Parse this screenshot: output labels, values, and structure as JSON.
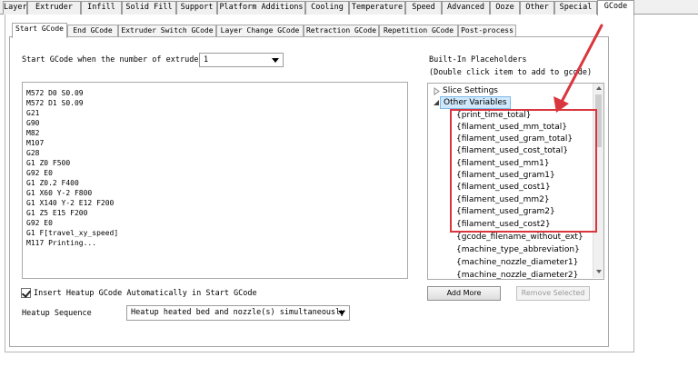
{
  "top_tabs": {
    "items": [
      "Layer",
      "Extruder",
      "Infill",
      "Solid Fill",
      "Support",
      "Platform Additions",
      "Cooling",
      "Temperature",
      "Speed",
      "Advanced",
      "Ooze",
      "Other",
      "Special",
      "GCode"
    ],
    "active": "GCode"
  },
  "sub_tabs": {
    "items": [
      "Start GCode",
      "End GCode",
      "Extruder Switch GCode",
      "Layer Change GCode",
      "Retraction GCode",
      "Repetition GCode",
      "Post-process"
    ],
    "active": "Start GCode"
  },
  "extruder_count": {
    "label": "Start GCode when the number of extruders is",
    "value": "1"
  },
  "gcode_lines": [
    "M572 D0 S0.09",
    "M572 D1 S0.09",
    "G21",
    "G90",
    "M82",
    "M107",
    "G28",
    "G1 Z0 F500",
    "G92 E0",
    "G1 Z0.2 F400",
    "G1 X60 Y-2 F800",
    "G1 X140 Y-2 E12 F200",
    "G1 Z5 E15 F200",
    "G92 E0",
    "G1 F[travel_xy_speed]",
    "M117 Printing..."
  ],
  "placeholders": {
    "title": "Built-In Placeholders",
    "hint": "(Double click item to add to gcode)",
    "groups": [
      "Slice Settings",
      "Other Variables"
    ],
    "items": [
      "{print_time_total}",
      "{filament_used_mm_total}",
      "{filament_used_gram_total}",
      "{filament_used_cost_total}",
      "{filament_used_mm1}",
      "{filament_used_gram1}",
      "{filament_used_cost1}",
      "{filament_used_mm2}",
      "{filament_used_gram2}",
      "{filament_used_cost2}",
      "{gcode_filename_without_ext}",
      "{machine_type_abbreviation}",
      "{machine_nozzle_diameter1}",
      "{machine_nozzle_diameter2}"
    ]
  },
  "buttons": {
    "add_more": "Add More",
    "remove_selected": "Remove Selected"
  },
  "heatup_checkbox": {
    "label": "Insert Heatup GCode Automatically in Start GCode",
    "checked": true
  },
  "heatup_sequence": {
    "label": "Heatup Sequence",
    "value": "Heatup heated bed and nozzle(s) simultaneously"
  },
  "colors": {
    "annotation_red": "#d9363e",
    "selection_blue": "#cfe8fc"
  }
}
